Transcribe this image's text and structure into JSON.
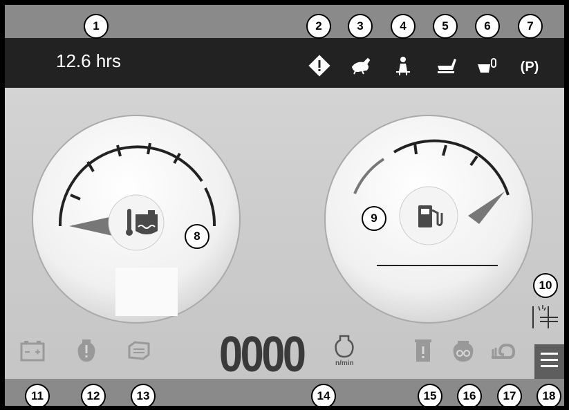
{
  "status_bar": {
    "hour_meter": "12.6 hrs"
  },
  "indicators": [
    {
      "name": "warning-icon"
    },
    {
      "name": "rabbit-speed-icon"
    },
    {
      "name": "operator-presence-icon"
    },
    {
      "name": "seat-icon"
    },
    {
      "name": "mower-deck-icon"
    },
    {
      "name": "parking-brake-icon",
      "label": "(P)"
    }
  ],
  "gauges": {
    "coolant": {
      "icon": "coolant-temperature-icon"
    },
    "fuel": {
      "icon": "fuel-pump-icon"
    }
  },
  "engine_speed": {
    "value": "0000",
    "unit": "n/min"
  },
  "bottom_icons": [
    "battery-icon",
    "oil-warning-icon",
    "air-filter-icon",
    "hydraulic-filter-icon",
    "glow-plug-icon",
    "turtle-slow-icon"
  ],
  "callouts": [
    "1",
    "2",
    "3",
    "4",
    "5",
    "6",
    "7",
    "8",
    "9",
    "10",
    "11",
    "12",
    "13",
    "14",
    "15",
    "16",
    "17",
    "18"
  ],
  "colors": {
    "statusbar": "#222222",
    "strip": "#8a8a8a",
    "counter": "#3a3a3a"
  }
}
